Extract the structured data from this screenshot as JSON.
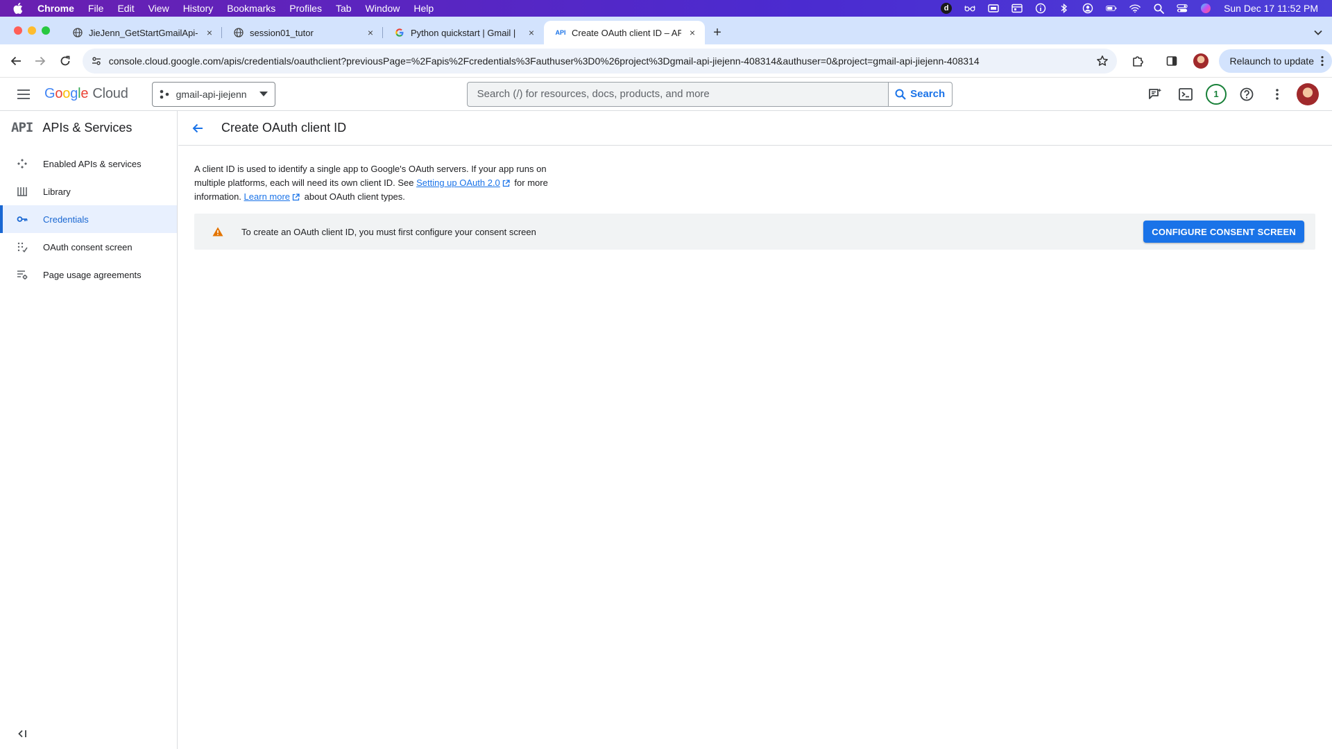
{
  "colors": {
    "accent": "#1a73e8",
    "menubar": "#5b24c4",
    "tabstrip": "#d3e3fd",
    "warning": "#e37400",
    "notification": "#188038"
  },
  "menubar": {
    "app_name": "Chrome",
    "items": [
      "File",
      "Edit",
      "View",
      "History",
      "Bookmarks",
      "Profiles",
      "Tab",
      "Window",
      "Help"
    ],
    "d_badge": "d",
    "datetime": "Sun Dec 17  11:52 PM"
  },
  "tabs": [
    {
      "title": "JieJenn_GetStartGmailApi-Py",
      "icon": "globe-icon",
      "close": "×"
    },
    {
      "title": "session01_tutor",
      "icon": "globe-icon",
      "close": "×"
    },
    {
      "title": "Python quickstart  |  Gmail  |",
      "icon": "google-g-icon",
      "close": "×"
    },
    {
      "title": "Create OAuth client ID – APIs",
      "icon": "api-icon",
      "favicon_text": "API",
      "close": "×"
    }
  ],
  "newtab_label": "+",
  "omnibox": {
    "url": "console.cloud.google.com/apis/credentials/oauthclient?previousPage=%2Fapis%2Fcredentials%3Fauthuser%3D0%26project%3Dgmail-api-jiejenn-408314&authuser=0&project=gmail-api-jiejenn-408314"
  },
  "relaunch_label": "Relaunch to update",
  "header": {
    "logo_google": "Google",
    "logo_cloud": "Cloud",
    "project": "gmail-api-jiejenn",
    "search_placeholder": "Search (/) for resources, docs, products, and more",
    "search_button": "Search",
    "notification_count": "1"
  },
  "sidebar": {
    "mark": "API",
    "title": "APIs & Services",
    "items": [
      {
        "label": "Enabled APIs & services",
        "icon": "enabled-apis-icon"
      },
      {
        "label": "Library",
        "icon": "library-icon"
      },
      {
        "label": "Credentials",
        "icon": "key-icon",
        "active": true
      },
      {
        "label": "OAuth consent screen",
        "icon": "consent-icon"
      },
      {
        "label": "Page usage agreements",
        "icon": "settings-list-icon"
      }
    ]
  },
  "main": {
    "title": "Create OAuth client ID",
    "desc_part1": "A client ID is used to identify a single app to Google's OAuth servers. If your app runs on multiple platforms, each will need its own client ID. See ",
    "link1": "Setting up OAuth 2.0",
    "desc_part2": " for more information. ",
    "link2": "Learn more",
    "desc_part3": " about OAuth client types.",
    "banner_text": "To create an OAuth client ID, you must first configure your consent screen",
    "banner_button": "CONFIGURE CONSENT SCREEN"
  }
}
